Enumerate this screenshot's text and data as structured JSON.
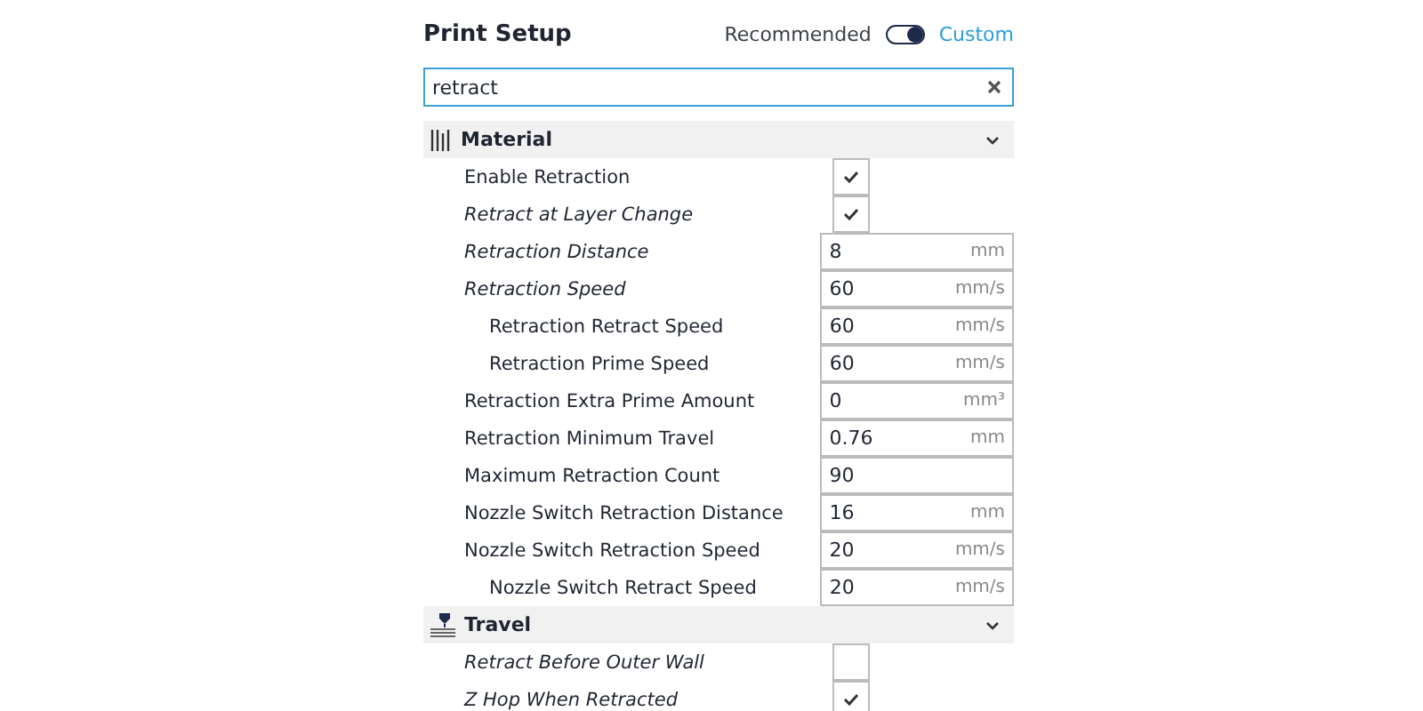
{
  "panel": {
    "title": "Print Setup"
  },
  "mode_switch": [
    {
      "label": "Recommended",
      "selected": false
    },
    {
      "label": "Custom",
      "selected": true
    }
  ],
  "search": {
    "value": "retract"
  },
  "categories": [
    {
      "title": "Material",
      "kind": "material",
      "expanded": true,
      "settings": [
        {
          "label": "Enable Retraction",
          "kind": "checkbox",
          "checked": true,
          "overridden": false
        },
        {
          "label": "Retract at Layer Change",
          "kind": "checkbox",
          "checked": true,
          "overridden": true
        },
        {
          "label": "Retraction Distance",
          "kind": "number",
          "value": "8",
          "unit": "mm",
          "overridden": true
        },
        {
          "label": "Retraction Speed",
          "kind": "number",
          "value": "60",
          "unit": "mm/s",
          "overridden": true,
          "children": [
            {
              "label": "Retraction Retract Speed",
              "kind": "number",
              "value": "60",
              "unit": "mm/s",
              "overridden": false
            },
            {
              "label": "Retraction Prime Speed",
              "kind": "number",
              "value": "60",
              "unit": "mm/s",
              "overridden": false
            }
          ]
        },
        {
          "label": "Retraction Extra Prime Amount",
          "kind": "number",
          "value": "0",
          "unit": "mm³",
          "overridden": false
        },
        {
          "label": "Retraction Minimum Travel",
          "kind": "number",
          "value": "0.76",
          "unit": "mm",
          "overridden": false
        },
        {
          "label": "Maximum Retraction Count",
          "kind": "number",
          "value": "90",
          "overridden": false
        },
        {
          "label": "Nozzle Switch Retraction Distance",
          "kind": "number",
          "value": "16",
          "unit": "mm",
          "overridden": false
        },
        {
          "label": "Nozzle Switch Retraction Speed",
          "kind": "number",
          "value": "20",
          "unit": "mm/s",
          "overridden": false,
          "children": [
            {
              "label": "Nozzle Switch Retract Speed",
              "kind": "number",
              "value": "20",
              "unit": "mm/s",
              "overridden": false
            }
          ]
        }
      ]
    },
    {
      "title": "Travel",
      "kind": "travel",
      "expanded": true,
      "settings": [
        {
          "label": "Retract Before Outer Wall",
          "kind": "checkbox",
          "checked": false,
          "overridden": true
        },
        {
          "label": "Z Hop When Retracted",
          "kind": "checkbox",
          "checked": true,
          "overridden": true
        }
      ]
    }
  ]
}
